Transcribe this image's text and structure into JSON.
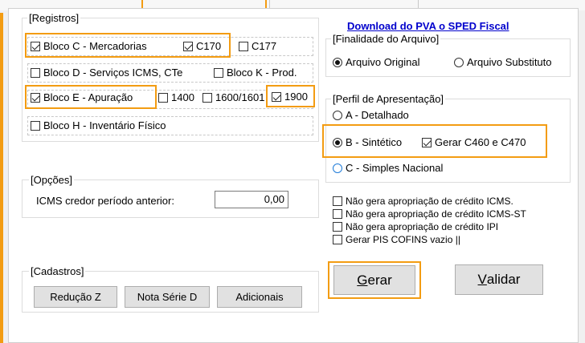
{
  "download_link": "Download do PVA o SPED Fiscal",
  "registros": {
    "title": "[Registros]",
    "bloco_c": "Bloco C - Mercadorias",
    "c170": "C170",
    "c177": "C177",
    "bloco_d": "Bloco D - Serviços ICMS, CTe",
    "bloco_k": "Bloco K - Prod.",
    "bloco_e": "Bloco E - Apuração",
    "r1400": "1400",
    "r1600": "1600/1601",
    "r1900": "1900",
    "bloco_h": "Bloco H - Inventário Físico"
  },
  "finalidade": {
    "title": "[Finalidade do Arquivo]",
    "original": "Arquivo Original",
    "substituto": "Arquivo Substituto"
  },
  "perfil": {
    "title": "[Perfil de Apresentação]",
    "a": "A - Detalhado",
    "b": "B - Sintético",
    "gerar_c460": "Gerar C460 e C470",
    "c": "C - Simples Nacional"
  },
  "opcoes": {
    "title": "[Opções]",
    "icms_label": "ICMS credor período anterior:",
    "icms_value": "0,00"
  },
  "flags": {
    "nao_icms": "Não gera apropriação de crédito ICMS.",
    "nao_icms_st": "Não gera apropriação de crédito ICMS-ST",
    "nao_ipi": "Não gera apropriação de crédito IPI",
    "pis_cofins": "Gerar PIS COFINS vazio ||"
  },
  "cadastros": {
    "title": "[Cadastros]",
    "reducao_z": "Redução Z",
    "nota_serie_d": "Nota Série D",
    "adicionais": "Adicionais"
  },
  "actions": {
    "gerar_prefix": "G",
    "gerar_rest": "erar",
    "validar_prefix": "V",
    "validar_rest": "alidar"
  },
  "colors": {
    "highlight": "#f39c12",
    "link": "#0000cc",
    "radio_blue": "#1e7bd8"
  }
}
